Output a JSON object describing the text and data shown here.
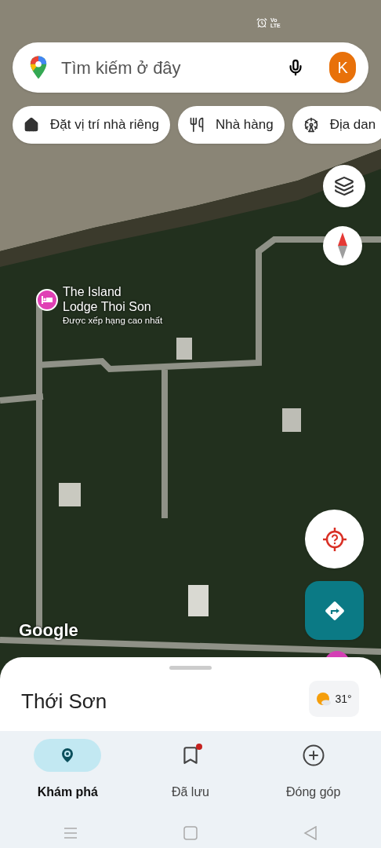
{
  "status_bar": {
    "network": "Vo LTE"
  },
  "search": {
    "placeholder": "Tìm kiếm ở đây",
    "avatar": "K"
  },
  "chips": [
    {
      "kind": "home",
      "label": "Đặt vị trí nhà riêng"
    },
    {
      "kind": "restaurant",
      "label": "Nhà hàng"
    },
    {
      "kind": "attraction",
      "label": "Địa dan"
    }
  ],
  "map": {
    "place": {
      "name": "The Island Lodge Thoi Son",
      "subtitle": "Được xếp hạng cao nhất"
    },
    "attribution": "Google"
  },
  "sheet": {
    "title": "Thới Sơn",
    "temperature": "31°"
  },
  "nav": [
    {
      "kind": "explore",
      "label": "Khám phá",
      "selected": true,
      "badge": false
    },
    {
      "kind": "saved",
      "label": "Đã lưu",
      "selected": false,
      "badge": true
    },
    {
      "kind": "contribute",
      "label": "Đóng góp",
      "selected": false,
      "badge": false
    }
  ]
}
